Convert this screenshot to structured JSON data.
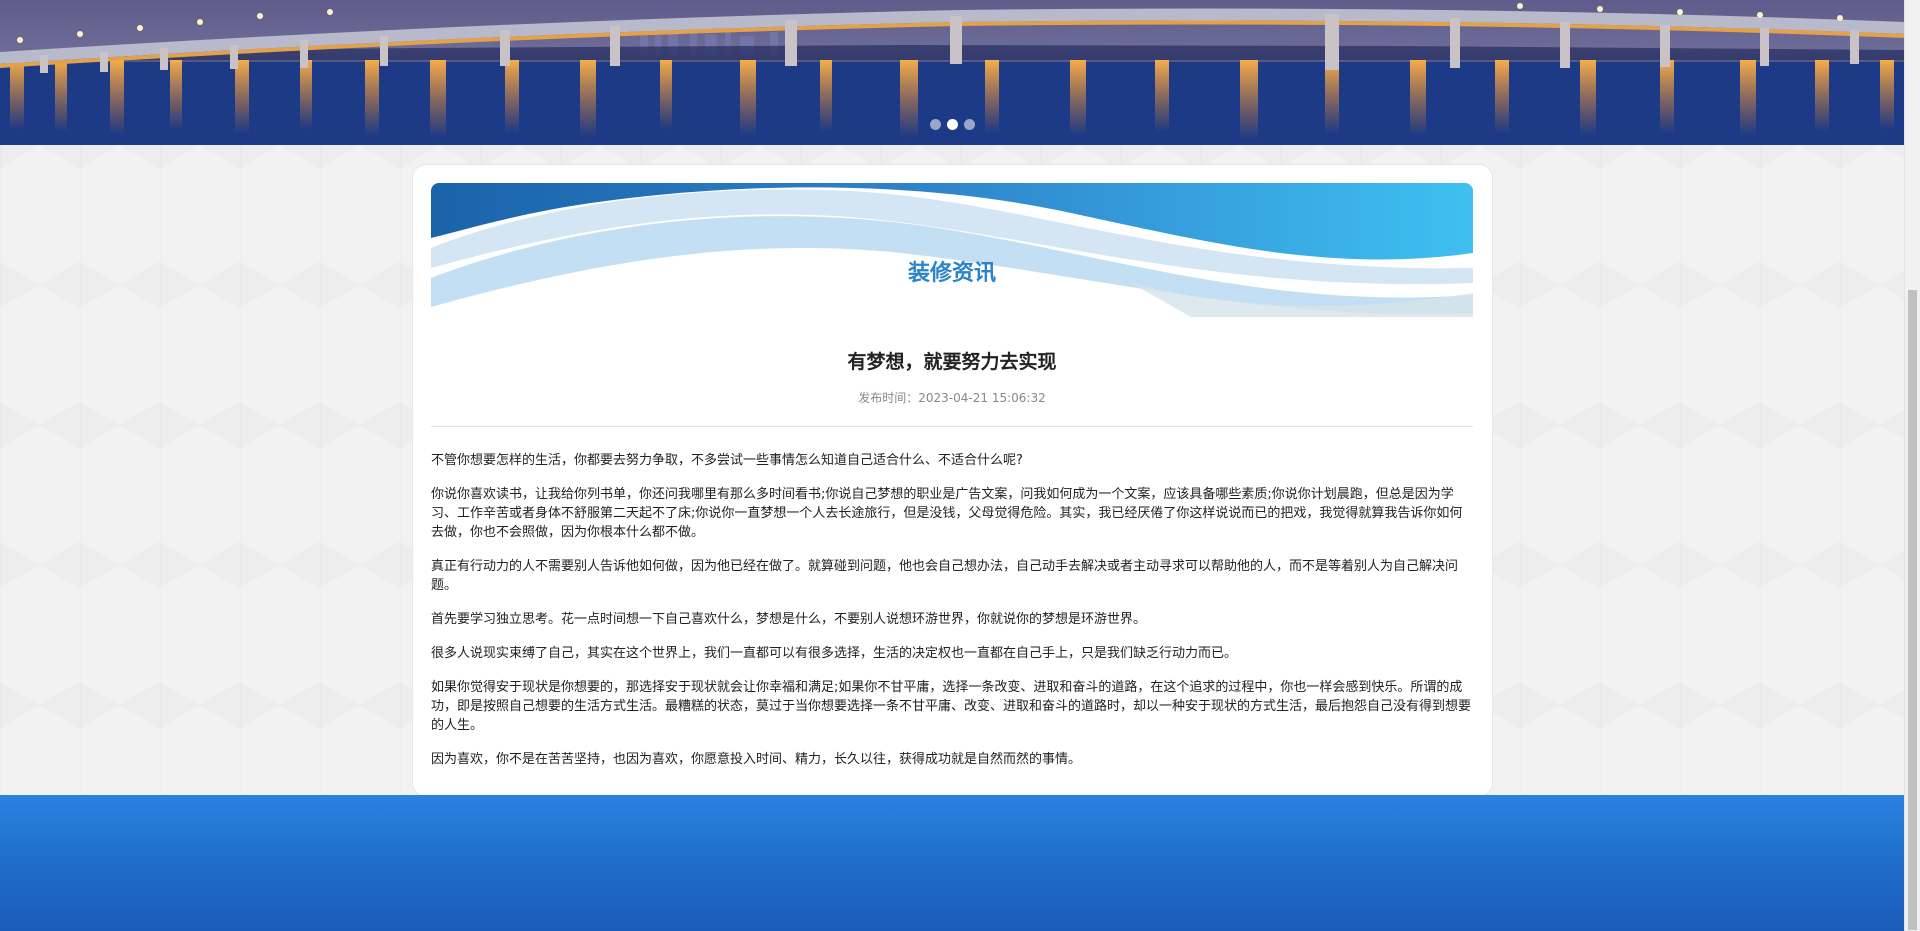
{
  "banner": {
    "slides": [
      "slide-1",
      "slide-2",
      "slide-3"
    ],
    "active_slide": 2
  },
  "section": {
    "title": "装修资讯"
  },
  "article": {
    "title": "有梦想，就要努力去实现",
    "meta": "发布时间：2023-04-21 15:06:32",
    "paragraphs": [
      "不管你想要怎样的生活，你都要去努力争取，不多尝试一些事情怎么知道自己适合什么、不适合什么呢?",
      "你说你喜欢读书，让我给你列书单，你还问我哪里有那么多时间看书;你说自己梦想的职业是广告文案，问我如何成为一个文案，应该具备哪些素质;你说你计划晨跑，但总是因为学习、工作辛苦或者身体不舒服第二天起不了床;你说你一直梦想一个人去长途旅行，但是没钱，父母觉得危险。其实，我已经厌倦了你这样说说而已的把戏，我觉得就算我告诉你如何去做，你也不会照做，因为你根本什么都不做。",
      "真正有行动力的人不需要别人告诉他如何做，因为他已经在做了。就算碰到问题，他也会自己想办法，自己动手去解决或者主动寻求可以帮助他的人，而不是等着别人为自己解决问题。",
      "首先要学习独立思考。花一点时间想一下自己喜欢什么，梦想是什么，不要别人说想环游世界，你就说你的梦想是环游世界。",
      "很多人说现实束缚了自己，其实在这个世界上，我们一直都可以有很多选择，生活的决定权也一直都在自己手上，只是我们缺乏行动力而已。",
      "如果你觉得安于现状是你想要的，那选择安于现状就会让你幸福和满足;如果你不甘平庸，选择一条改变、进取和奋斗的道路，在这个追求的过程中，你也一样会感到快乐。所谓的成功，即是按照自己想要的生活方式生活。最糟糕的状态，莫过于当你想要选择一条不甘平庸、改变、进取和奋斗的道路时，却以一种安于现状的方式生活，最后抱怨自己没有得到想要的人生。",
      "因为喜欢，你不是在苦苦坚持，也因为喜欢，你愿意投入时间、精力，长久以往，获得成功就是自然而然的事情。"
    ]
  },
  "colors": {
    "section_title": "#2a84c9",
    "footer": "#1f6fcc"
  }
}
